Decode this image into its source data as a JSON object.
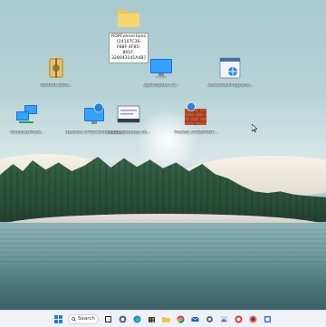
{
  "desktop": {
    "icons": [
      {
        "id": "rdp-folder",
        "label": "RDPConnections.{24107C36-F88F-4F85-801F-328043141A4B}",
        "selected": true
      },
      {
        "id": "winrar",
        "label": "WinRAR.{2C0..."
      },
      {
        "id": "mycomputer",
        "label": "MyComputer.{2..."
      },
      {
        "id": "network-programs",
        "label": "NetworkedPrograms..."
      },
      {
        "id": "windows-firewall",
        "label": "WindowsFireW..."
      },
      {
        "id": "network",
        "label": "Network.{F02C1A0D-BE21...}"
      },
      {
        "id": "remote-desktop",
        "label": "RemoteDesktop.{B..."
      },
      {
        "id": "firewall",
        "label": "Firewall.{4026492F..."
      }
    ]
  },
  "taskbar": {
    "search_label": "Search",
    "apps": [
      "file-explorer",
      "task-view",
      "teams",
      "edge",
      "store",
      "chrome",
      "mail",
      "settings",
      "photos",
      "terminal",
      "firefox",
      "app"
    ]
  }
}
